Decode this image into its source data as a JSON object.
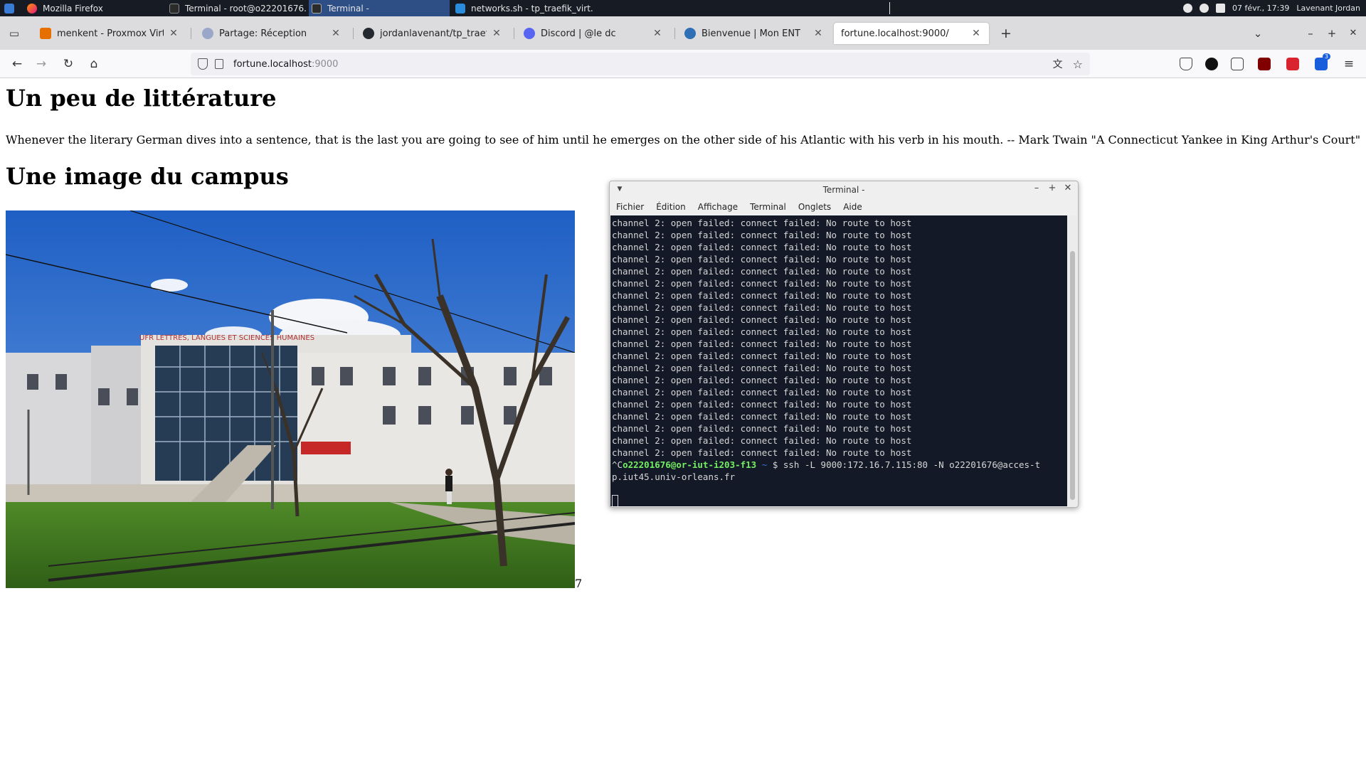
{
  "taskbar": {
    "windows": [
      {
        "title": "Mozilla Firefox",
        "active": false
      },
      {
        "title": "Terminal - root@o22201676...",
        "active": false
      },
      {
        "title": "Terminal -",
        "active": true
      },
      {
        "title": "networks.sh - tp_traefik_virt...",
        "active": false
      }
    ],
    "clock": "07 févr., 17:39",
    "user": "Lavenant Jordan"
  },
  "browser": {
    "tabs": [
      {
        "title": "menkent - Proxmox Virtual En",
        "icon": "proxmox-icon",
        "color": "#e57000"
      },
      {
        "title": "Partage: Réception",
        "icon": "zimbra-icon",
        "color": "#9aa7c9"
      },
      {
        "title": "jordanlavenant/tp_traefik_virt",
        "icon": "github-icon",
        "color": "#24292f"
      },
      {
        "title": "Discord | @le dc",
        "icon": "discord-icon",
        "color": "#5865f2"
      },
      {
        "title": "Bienvenue | Mon ENT",
        "icon": "ent-icon",
        "color": "#2f6fb5"
      },
      {
        "title": "fortune.localhost:9000/",
        "icon": "page-icon",
        "color": "#ffffff"
      }
    ],
    "url_host": "fortune.localhost",
    "url_port": ":9000",
    "extension_badge": "3"
  },
  "page": {
    "heading_literature": "Un peu de littérature",
    "quote": "Whenever the literary German dives into a sentence, that is the last you are going to see of him until he emerges on the other side of his Atlantic with his verb in his mouth. -- Mark Twain \"A Connecticut Yankee in King Arthur's Court\"",
    "heading_campus": "Une image du campus",
    "campus_sign": "UFR LETTRES, LANGUES ET SCIENCES HUMAINES",
    "stray_char": "7"
  },
  "terminal": {
    "title": "Terminal -",
    "menu": [
      "Fichier",
      "Édition",
      "Affichage",
      "Terminal",
      "Onglets",
      "Aide"
    ],
    "error_line": "channel 2: open failed: connect failed: No route to host",
    "error_lines": [
      "channel 2: open failed: connect failed: No route to host",
      "channel 2: open failed: connect failed: No route to host",
      "channel 2: open failed: connect failed: No route to host",
      "channel 2: open failed: connect failed: No route to host",
      "channel 2: open failed: connect failed: No route to host",
      "channel 2: open failed: connect failed: No route to host",
      "channel 2: open failed: connect failed: No route to host",
      "channel 2: open failed: connect failed: No route to host",
      "channel 2: open failed: connect failed: No route to host",
      "channel 2: open failed: connect failed: No route to host",
      "channel 2: open failed: connect failed: No route to host",
      "channel 2: open failed: connect failed: No route to host",
      "channel 2: open failed: connect failed: No route to host",
      "channel 2: open failed: connect failed: No route to host",
      "channel 2: open failed: connect failed: No route to host",
      "channel 2: open failed: connect failed: No route to host",
      "channel 2: open failed: connect failed: No route to host",
      "channel 2: open failed: connect failed: No route to host",
      "channel 2: open failed: connect failed: No route to host",
      "channel 2: open failed: connect failed: No route to host"
    ],
    "prompt_prefix": "^C",
    "prompt_user": "o22201676@or-iut-i203-f13",
    "prompt_dir": "~",
    "prompt_symbol": "$",
    "command_line1": "ssh -L 9000:172.16.7.115:80 -N o22201676@acces-t",
    "command_line2": "p.iut45.univ-orleans.fr"
  }
}
